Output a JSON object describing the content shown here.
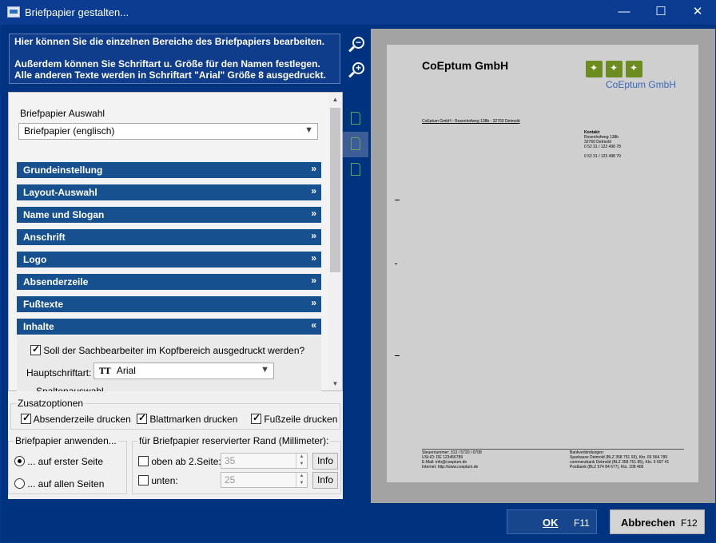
{
  "window": {
    "title": "Briefpapier gestalten...",
    "controls": {
      "minimize": "—",
      "maximize": "☐",
      "close": "✕"
    }
  },
  "info": {
    "line1": "Hier können Sie die einzelnen Bereiche des Briefpapiers bearbeiten.",
    "line2": "Außerdem können Sie Schriftart u. Größe für den Namen festlegen.",
    "line3": "Alle anderen Texte werden in Schriftart \"Arial\" Größe 8 ausgedruckt."
  },
  "zoom": {
    "out": "−",
    "in": "+"
  },
  "selection": {
    "label": "Briefpapier Auswahl",
    "value": "Briefpapier (englisch)"
  },
  "sections": [
    {
      "label": "Grundeinstellung",
      "state": "collapsed"
    },
    {
      "label": "Layout-Auswahl",
      "state": "collapsed"
    },
    {
      "label": "Name und Slogan",
      "state": "collapsed"
    },
    {
      "label": "Anschrift",
      "state": "collapsed"
    },
    {
      "label": "Logo",
      "state": "collapsed"
    },
    {
      "label": "Absenderzeile",
      "state": "collapsed"
    },
    {
      "label": "Fußtexte",
      "state": "collapsed"
    },
    {
      "label": "Inhalte",
      "state": "expanded"
    }
  ],
  "inhalte": {
    "checkbox_label": "Soll der Sachbearbeiter im Kopfbereich ausgedruckt werden?",
    "checkbox_checked": true,
    "font_label": "Hauptschriftart:",
    "font_value": "Arial",
    "font_icon": "TT",
    "columns_label": "Spaltenauswahl"
  },
  "zusatz": {
    "legend": "Zusatzoptionen",
    "options": [
      {
        "label": "Absenderzeile drucken",
        "checked": true
      },
      {
        "label": "Blattmarken drucken",
        "checked": true
      },
      {
        "label": "Fußzeile drucken",
        "checked": true
      }
    ]
  },
  "anwenden": {
    "legend": "Briefpapier anwenden...",
    "options": [
      {
        "label": "... auf erster Seite",
        "selected": true
      },
      {
        "label": "... auf allen Seiten",
        "selected": false
      }
    ]
  },
  "rand": {
    "legend": "für Briefpapier reservierter Rand (Millimeter):",
    "rows": [
      {
        "label": "oben ab 2.Seite:",
        "value": "35",
        "checked": false,
        "button": "Info"
      },
      {
        "label": "unten:",
        "value": "25",
        "checked": false,
        "button": "Info"
      }
    ]
  },
  "preview": {
    "company": "CoEptum GmbH",
    "logo_text": "CoEptum GmbH",
    "sender_line": "CoEptum GmbH - Rosenhofweg 138b - 32760 Detmold",
    "contact": {
      "heading": "Kontakt:",
      "lines": [
        "Rosenhofweg 138b",
        "32760 Detmold",
        "0 52 31 / 123 498 78",
        "",
        "0 52 31 / 123 498 79"
      ]
    },
    "footer_left": [
      "Steuernummer: 313 / 5720 / 0708",
      "USt-ID: DE 123456789",
      "E-Mail: info@coeptum.de",
      "Internet: http://www.coeptum.de"
    ],
    "footer_right": [
      "Bankverbindungen:",
      "Sparkasse Detmold (BLZ 358 751 93), Kto. 65 564 789",
      "commerzbank Detmold (BLZ 358 751 85), Kto. 5 697 41",
      "Postbank (BLZ 574 84 677), Kto. 108 406"
    ]
  },
  "buttons": {
    "ok": "OK",
    "ok_key": "F11",
    "cancel": "Abbrechen",
    "cancel_key": "F12"
  }
}
